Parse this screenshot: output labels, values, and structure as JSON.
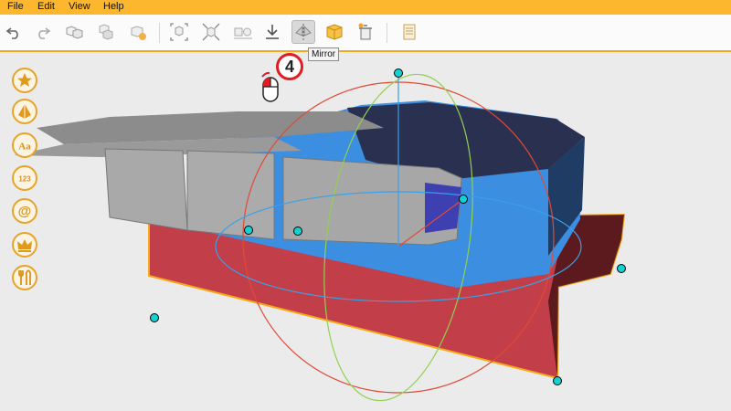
{
  "menu": {
    "items": [
      "File",
      "Edit",
      "View",
      "Help"
    ]
  },
  "toolbar": {
    "buttons": [
      {
        "icon": "undo-icon"
      },
      {
        "icon": "redo-icon"
      },
      {
        "icon": "duplicate-icon"
      },
      {
        "icon": "group-icon"
      },
      {
        "icon": "add-part-icon"
      },
      {
        "icon": "fit-view-icon"
      },
      {
        "icon": "snap-icon"
      },
      {
        "icon": "align-icon"
      },
      {
        "icon": "download-icon"
      },
      {
        "icon": "mirror-icon",
        "active": true
      },
      {
        "icon": "box-icon"
      },
      {
        "icon": "trash-icon"
      },
      {
        "icon": "notes-icon"
      }
    ],
    "tooltip": "Mirror"
  },
  "sidebar": {
    "items": [
      {
        "icon": "star-icon"
      },
      {
        "icon": "shape-icon"
      },
      {
        "icon": "text-icon",
        "label": "Aa"
      },
      {
        "icon": "numbers-icon",
        "label": "123"
      },
      {
        "icon": "at-symbol-icon",
        "label": "@"
      },
      {
        "icon": "crown-icon"
      },
      {
        "icon": "tools-icon"
      }
    ]
  },
  "annotation": {
    "step_number": "4",
    "icon": "mouse-left-click-icon"
  },
  "colors": {
    "menubar": "#fcb72f",
    "accent": "#f6a81d",
    "base_box": "#c23e48",
    "blue_body": "#3c8ee0",
    "dark_body": "#2a3050",
    "key_gray": "#a9a9a9",
    "gizmo_red": "#e04a35",
    "gizmo_green": "#8fd14f",
    "gizmo_blue": "#3aa0e8",
    "handle": "#14d2d2",
    "badge_red": "#e21c23"
  }
}
